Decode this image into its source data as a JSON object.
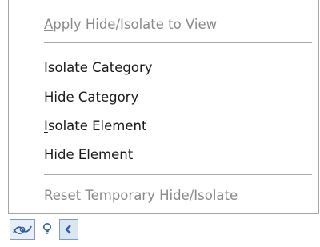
{
  "menu": {
    "items": [
      {
        "label_before": "",
        "label_u": "A",
        "label_after": "pply Hide/Isolate to View",
        "enabled": false
      },
      {
        "label_before": "Isolate Category",
        "label_u": "",
        "label_after": "",
        "enabled": true
      },
      {
        "label_before": "Hide Category",
        "label_u": "",
        "label_after": "",
        "enabled": true
      },
      {
        "label_before": "",
        "label_u": "I",
        "label_after": "solate Element",
        "enabled": true
      },
      {
        "label_before": "",
        "label_u": "H",
        "label_after": "ide Element",
        "enabled": true
      },
      {
        "label_before": "Reset Temporary Hide/Isolate",
        "label_u": "",
        "label_after": "",
        "enabled": false
      }
    ]
  },
  "statusbar": {
    "icons": [
      "temporary-hide-isolate-icon",
      "lightbulb-icon",
      "collapse-arrow-icon"
    ],
    "accent_color": "#2f5ea8",
    "border_color": "#7f9db9"
  }
}
